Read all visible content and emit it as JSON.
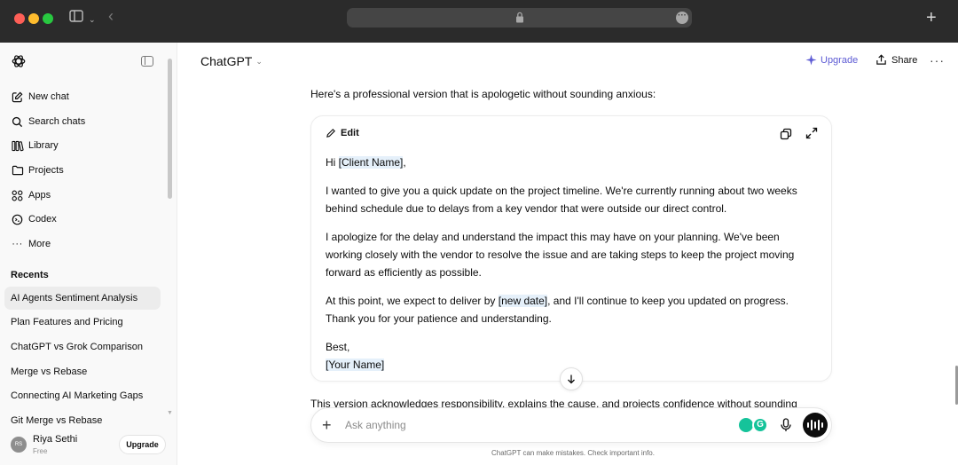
{
  "sidebar": {
    "nav": [
      {
        "label": "New chat",
        "icon": "pencil-square-icon"
      },
      {
        "label": "Search chats",
        "icon": "search-icon"
      },
      {
        "label": "Library",
        "icon": "library-icon"
      },
      {
        "label": "Projects",
        "icon": "folder-icon"
      },
      {
        "label": "Apps",
        "icon": "apps-grid-icon"
      },
      {
        "label": "Codex",
        "icon": "codex-icon"
      },
      {
        "label": "More",
        "icon": "more-dots-icon"
      }
    ],
    "recents_heading": "Recents",
    "recents": [
      "AI Agents Sentiment Analysis",
      "Plan Features and Pricing",
      "ChatGPT vs Grok Comparison",
      "Merge vs Rebase",
      "Connecting AI Marketing Gaps",
      "Git Merge vs Rebase"
    ],
    "user": {
      "initials": "RS",
      "name": "Riya Sethi",
      "plan": "Free",
      "upgrade_label": "Upgrade"
    }
  },
  "header": {
    "model": "ChatGPT",
    "upgrade_label": "Upgrade",
    "share_label": "Share",
    "accent": "#5d5bd4"
  },
  "conversation": {
    "intro": "Here's a professional version that is apologetic without sounding anxious:",
    "card": {
      "edit_label": "Edit",
      "greeting_prefix": "Hi ",
      "client_placeholder": "[Client Name]",
      "greeting_suffix": ",",
      "para1": "I wanted to give you a quick update on the project timeline. We're currently running about two weeks behind schedule due to delays from a key vendor that were outside our direct control.",
      "para2": "I apologize for the delay and understand the impact this may have on your planning. We've been working closely with the vendor to resolve the issue and are taking steps to keep the project moving forward as efficiently as possible.",
      "para3_prefix": "At this point, we expect to deliver by ",
      "date_placeholder": "[new date]",
      "para3_suffix": ", and I'll continue to keep you updated on progress. Thank you for your patience and understanding.",
      "signoff": "Best,",
      "name_placeholder": "[Your Name]"
    },
    "outro": "This version acknowledges responsibility, explains the cause, and projects confidence without sounding"
  },
  "composer": {
    "placeholder": "Ask anything",
    "grammarly_letter": "G"
  },
  "disclaimer": "ChatGPT can make mistakes. Check important info."
}
